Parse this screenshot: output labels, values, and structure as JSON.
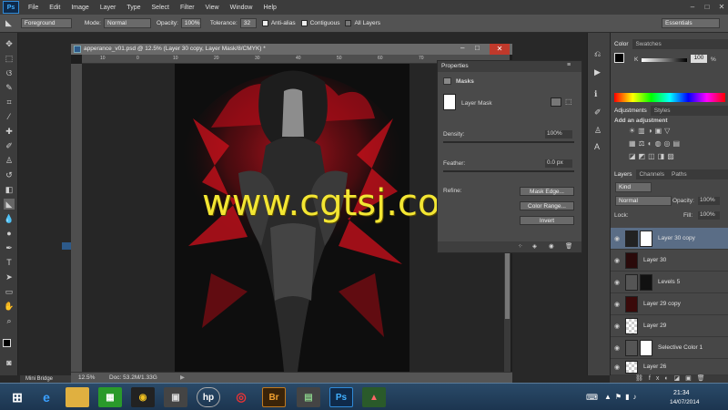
{
  "menubar": {
    "logo": "Ps",
    "items": [
      "File",
      "Edit",
      "Image",
      "Layer",
      "Type",
      "Select",
      "Filter",
      "View",
      "Window",
      "Help"
    ]
  },
  "options": {
    "fill_source": "Foreground",
    "mode_label": "Mode:",
    "mode_value": "Normal",
    "opacity_label": "Opacity:",
    "opacity_value": "100%",
    "tolerance_label": "Tolerance:",
    "tolerance_value": "32",
    "antialias_label": "Anti-alias",
    "contiguous_label": "Contiguous",
    "all_layers_label": "All Layers",
    "workspace": "Essentials"
  },
  "document": {
    "title": "apperance_v01.psd @ 12.5% (Layer 30 copy, Layer Mask/8/CMYK) *",
    "zoom": "12.5%",
    "doc_size": "Doc: 53.2M/1.33G",
    "mini_bridge": "Mini Bridge",
    "ruler_numbers": [
      "10",
      "0",
      "10",
      "20",
      "30",
      "40",
      "50",
      "60",
      "70"
    ]
  },
  "properties": {
    "title": "Properties",
    "section": "Masks",
    "layer_mask": "Layer Mask",
    "density_label": "Density:",
    "density_value": "100%",
    "feather_label": "Feather:",
    "feather_value": "0.0 px",
    "refine_label": "Refine:",
    "mask_edge": "Mask Edge...",
    "color_range": "Color Range...",
    "invert": "Invert"
  },
  "color_panel": {
    "tabs": [
      "Color",
      "Swatches"
    ],
    "k_label": "K",
    "k_value": "100",
    "k_unit": "%"
  },
  "adjustments": {
    "tabs": [
      "Adjustments",
      "Styles"
    ],
    "heading": "Add an adjustment"
  },
  "layers_panel": {
    "tabs": [
      "Layers",
      "Channels",
      "Paths"
    ],
    "kind": "Kind",
    "blend": "Normal",
    "opacity_label": "Opacity:",
    "opacity_value": "100%",
    "lock_label": "Lock:",
    "fill_label": "Fill:",
    "fill_value": "100%",
    "layers": [
      {
        "name": "Layer 30 copy"
      },
      {
        "name": "Layer 30"
      },
      {
        "name": "Levels 5"
      },
      {
        "name": "Layer 29 copy"
      },
      {
        "name": "Layer 29"
      },
      {
        "name": "Selective Color 1"
      },
      {
        "name": "Layer 26"
      }
    ]
  },
  "taskbar": {
    "time": "21:34",
    "date": "14/07/2014",
    "apps": [
      "Br",
      "Ps"
    ]
  },
  "watermark": "www.cgtsj.com"
}
